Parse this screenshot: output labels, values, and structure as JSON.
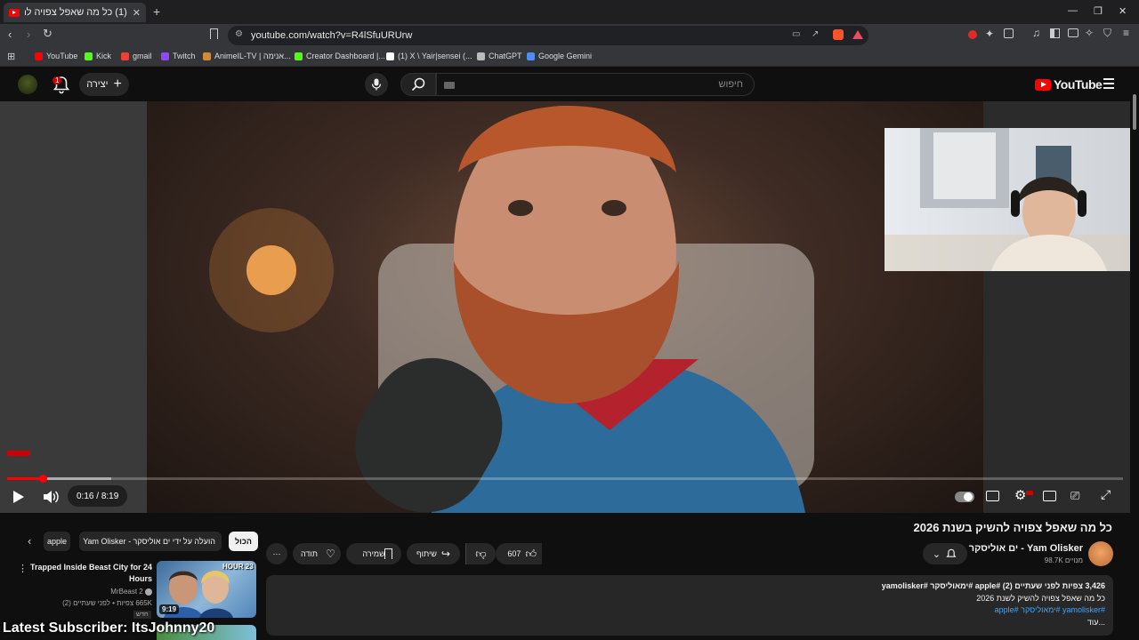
{
  "browser": {
    "tab_title": "(1) כל מה שאפל צפויה להשיק ב...",
    "tab_close": "✕",
    "new_tab": "+",
    "url": "youtube.com/watch?v=R4lSfuURUrw",
    "window_controls": [
      "—",
      "❐",
      "✕"
    ]
  },
  "bookmarks": [
    {
      "label": "YouTube",
      "color": "#ff0000"
    },
    {
      "label": "Kick",
      "color": "#53fc18"
    },
    {
      "label": "gmail",
      "color": "#ea4335"
    },
    {
      "label": "Twitch",
      "color": "#9146ff"
    },
    {
      "label": "AnimeIL-TV | אנימה...",
      "color": "#d08b3a"
    },
    {
      "label": "Creator Dashboard |...",
      "color": "#53fc18"
    },
    {
      "label": "(1) X \\ Yair|sensei (...",
      "color": "#ffffff"
    },
    {
      "label": "ChatGPT",
      "color": "#bbbbbb"
    },
    {
      "label": "Google Gemini",
      "color": "#4f8cf7"
    }
  ],
  "header": {
    "search_placeholder": "חיפוש",
    "create_label": "יצירה",
    "notifications_count": "1",
    "logo_text": "YouTube"
  },
  "player": {
    "time_current": "0:16",
    "time_separator": " / ",
    "time_total": "8:19",
    "progress_played": 0.032,
    "progress_loaded": 0.093
  },
  "video": {
    "title": "כל מה שאפל צפויה להשיק בשנת 2026",
    "channel_name": "ים אוליסקר - Yam Olisker",
    "channel_subs": "98.7K מנויים",
    "likes": "607",
    "share_label": "שיתוף",
    "save_label": "שמירה",
    "thanks_label": "תודה",
    "more_label": "⋯"
  },
  "description": {
    "stats": "3,426 צפיות  לפני שעתיים (2)  #apple #ימאוליסקר #yamolisker",
    "line1": "כל מה שאפל צפויה להשיק לשנת 2026",
    "hashtags": "#yamolisker #ימאוליסקר #apple",
    "more": "...עוד"
  },
  "chips": {
    "all": "הכול",
    "uploaded_by": "הועלה על ידי ים אוליסקר - Yam Olisker",
    "apple": "apple"
  },
  "recommendation": {
    "title": "Trapped Inside Beast City for 24 Hours",
    "channel": "MrBeast 2",
    "meta": "665K צפיות • לפני שעתיים (2)",
    "badge_new": "חדש",
    "duration": "9:19",
    "thumb_text": "HOUR 23"
  },
  "overlay": {
    "text": "Latest Subscriber: ItsJohnny20"
  }
}
